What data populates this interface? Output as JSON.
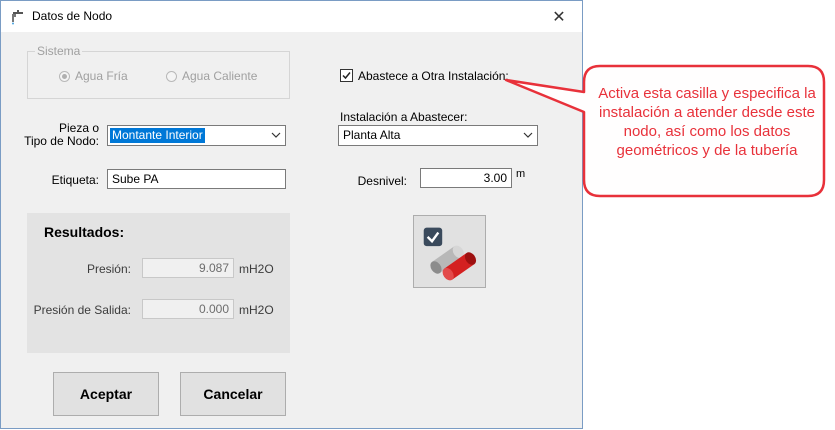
{
  "window": {
    "title": "Datos de Nodo",
    "close_glyph": "✕"
  },
  "sistema": {
    "title": "Sistema",
    "options": [
      {
        "label": "Agua Fría",
        "selected": true
      },
      {
        "label": "Agua Caliente",
        "selected": false
      }
    ]
  },
  "pieza": {
    "label_line1": "Pieza o",
    "label_line2": "Tipo de Nodo:",
    "value": "Montante Interior"
  },
  "etiqueta": {
    "label": "Etiqueta:",
    "value": "Sube PA"
  },
  "abastece": {
    "label": "Abastece a Otra Instalación:",
    "checked": true
  },
  "instalacion": {
    "label": "Instalación a Abastecer:",
    "value": "Planta Alta"
  },
  "desnivel": {
    "label": "Desnivel:",
    "value": "3.00",
    "unit": "m"
  },
  "resultados": {
    "title": "Resultados:",
    "presion": {
      "label": "Presión:",
      "value": "9.087",
      "unit": "mH2O"
    },
    "presion_salida": {
      "label": "Presión de Salida:",
      "value": "0.000",
      "unit": "mH2O"
    }
  },
  "buttons": {
    "accept": "Aceptar",
    "cancel": "Cancelar"
  },
  "callout": {
    "text": "Activa esta casilla y especifica la instalación a atender desde este nodo, así como los datos geométricos y de la tubería",
    "color": "#e8313a"
  },
  "icons": {
    "title": "faucet-icon",
    "pipes": "pipes-check-icon"
  }
}
